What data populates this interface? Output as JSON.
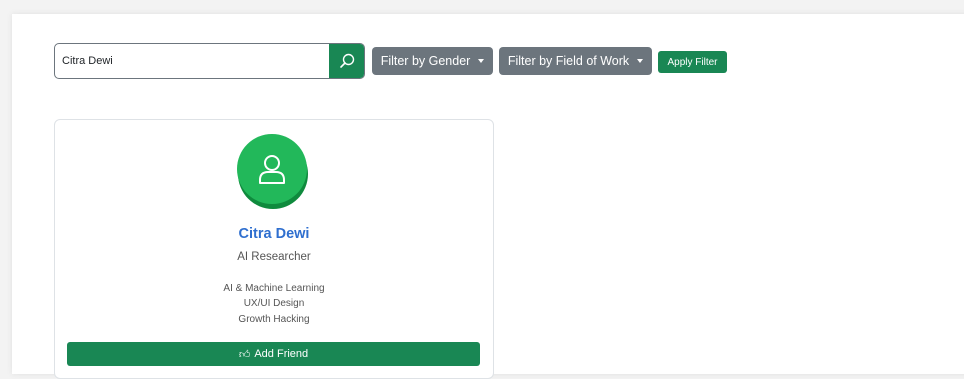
{
  "search": {
    "value": "Citra Dewi",
    "button_icon": "search-icon"
  },
  "filters": {
    "gender_label": "Filter by Gender",
    "field_label": "Filter by Field of Work",
    "apply_label": "Apply Filter"
  },
  "card": {
    "avatar_icon": "user-icon",
    "name": "Citra Dewi",
    "role": "AI Researcher",
    "skills": [
      "AI & Machine Learning",
      "UX/UI Design",
      "Growth Hacking"
    ],
    "add_friend_label": "Add Friend",
    "add_friend_icon": "thumbs-up-icon"
  },
  "colors": {
    "accent_green": "#198754",
    "gray_button": "#6c757d",
    "name_blue": "#2f6fcf",
    "avatar_green": "#22b85a"
  }
}
